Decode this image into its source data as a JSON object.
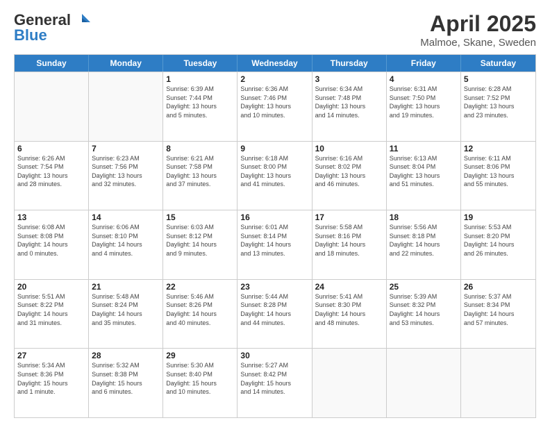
{
  "logo": {
    "line1": "General",
    "line2": "Blue"
  },
  "title": "April 2025",
  "subtitle": "Malmoe, Skane, Sweden",
  "days": [
    "Sunday",
    "Monday",
    "Tuesday",
    "Wednesday",
    "Thursday",
    "Friday",
    "Saturday"
  ],
  "rows": [
    [
      {
        "num": "",
        "info": ""
      },
      {
        "num": "",
        "info": ""
      },
      {
        "num": "1",
        "info": "Sunrise: 6:39 AM\nSunset: 7:44 PM\nDaylight: 13 hours\nand 5 minutes."
      },
      {
        "num": "2",
        "info": "Sunrise: 6:36 AM\nSunset: 7:46 PM\nDaylight: 13 hours\nand 10 minutes."
      },
      {
        "num": "3",
        "info": "Sunrise: 6:34 AM\nSunset: 7:48 PM\nDaylight: 13 hours\nand 14 minutes."
      },
      {
        "num": "4",
        "info": "Sunrise: 6:31 AM\nSunset: 7:50 PM\nDaylight: 13 hours\nand 19 minutes."
      },
      {
        "num": "5",
        "info": "Sunrise: 6:28 AM\nSunset: 7:52 PM\nDaylight: 13 hours\nand 23 minutes."
      }
    ],
    [
      {
        "num": "6",
        "info": "Sunrise: 6:26 AM\nSunset: 7:54 PM\nDaylight: 13 hours\nand 28 minutes."
      },
      {
        "num": "7",
        "info": "Sunrise: 6:23 AM\nSunset: 7:56 PM\nDaylight: 13 hours\nand 32 minutes."
      },
      {
        "num": "8",
        "info": "Sunrise: 6:21 AM\nSunset: 7:58 PM\nDaylight: 13 hours\nand 37 minutes."
      },
      {
        "num": "9",
        "info": "Sunrise: 6:18 AM\nSunset: 8:00 PM\nDaylight: 13 hours\nand 41 minutes."
      },
      {
        "num": "10",
        "info": "Sunrise: 6:16 AM\nSunset: 8:02 PM\nDaylight: 13 hours\nand 46 minutes."
      },
      {
        "num": "11",
        "info": "Sunrise: 6:13 AM\nSunset: 8:04 PM\nDaylight: 13 hours\nand 51 minutes."
      },
      {
        "num": "12",
        "info": "Sunrise: 6:11 AM\nSunset: 8:06 PM\nDaylight: 13 hours\nand 55 minutes."
      }
    ],
    [
      {
        "num": "13",
        "info": "Sunrise: 6:08 AM\nSunset: 8:08 PM\nDaylight: 14 hours\nand 0 minutes."
      },
      {
        "num": "14",
        "info": "Sunrise: 6:06 AM\nSunset: 8:10 PM\nDaylight: 14 hours\nand 4 minutes."
      },
      {
        "num": "15",
        "info": "Sunrise: 6:03 AM\nSunset: 8:12 PM\nDaylight: 14 hours\nand 9 minutes."
      },
      {
        "num": "16",
        "info": "Sunrise: 6:01 AM\nSunset: 8:14 PM\nDaylight: 14 hours\nand 13 minutes."
      },
      {
        "num": "17",
        "info": "Sunrise: 5:58 AM\nSunset: 8:16 PM\nDaylight: 14 hours\nand 18 minutes."
      },
      {
        "num": "18",
        "info": "Sunrise: 5:56 AM\nSunset: 8:18 PM\nDaylight: 14 hours\nand 22 minutes."
      },
      {
        "num": "19",
        "info": "Sunrise: 5:53 AM\nSunset: 8:20 PM\nDaylight: 14 hours\nand 26 minutes."
      }
    ],
    [
      {
        "num": "20",
        "info": "Sunrise: 5:51 AM\nSunset: 8:22 PM\nDaylight: 14 hours\nand 31 minutes."
      },
      {
        "num": "21",
        "info": "Sunrise: 5:48 AM\nSunset: 8:24 PM\nDaylight: 14 hours\nand 35 minutes."
      },
      {
        "num": "22",
        "info": "Sunrise: 5:46 AM\nSunset: 8:26 PM\nDaylight: 14 hours\nand 40 minutes."
      },
      {
        "num": "23",
        "info": "Sunrise: 5:44 AM\nSunset: 8:28 PM\nDaylight: 14 hours\nand 44 minutes."
      },
      {
        "num": "24",
        "info": "Sunrise: 5:41 AM\nSunset: 8:30 PM\nDaylight: 14 hours\nand 48 minutes."
      },
      {
        "num": "25",
        "info": "Sunrise: 5:39 AM\nSunset: 8:32 PM\nDaylight: 14 hours\nand 53 minutes."
      },
      {
        "num": "26",
        "info": "Sunrise: 5:37 AM\nSunset: 8:34 PM\nDaylight: 14 hours\nand 57 minutes."
      }
    ],
    [
      {
        "num": "27",
        "info": "Sunrise: 5:34 AM\nSunset: 8:36 PM\nDaylight: 15 hours\nand 1 minute."
      },
      {
        "num": "28",
        "info": "Sunrise: 5:32 AM\nSunset: 8:38 PM\nDaylight: 15 hours\nand 6 minutes."
      },
      {
        "num": "29",
        "info": "Sunrise: 5:30 AM\nSunset: 8:40 PM\nDaylight: 15 hours\nand 10 minutes."
      },
      {
        "num": "30",
        "info": "Sunrise: 5:27 AM\nSunset: 8:42 PM\nDaylight: 15 hours\nand 14 minutes."
      },
      {
        "num": "",
        "info": ""
      },
      {
        "num": "",
        "info": ""
      },
      {
        "num": "",
        "info": ""
      }
    ]
  ]
}
